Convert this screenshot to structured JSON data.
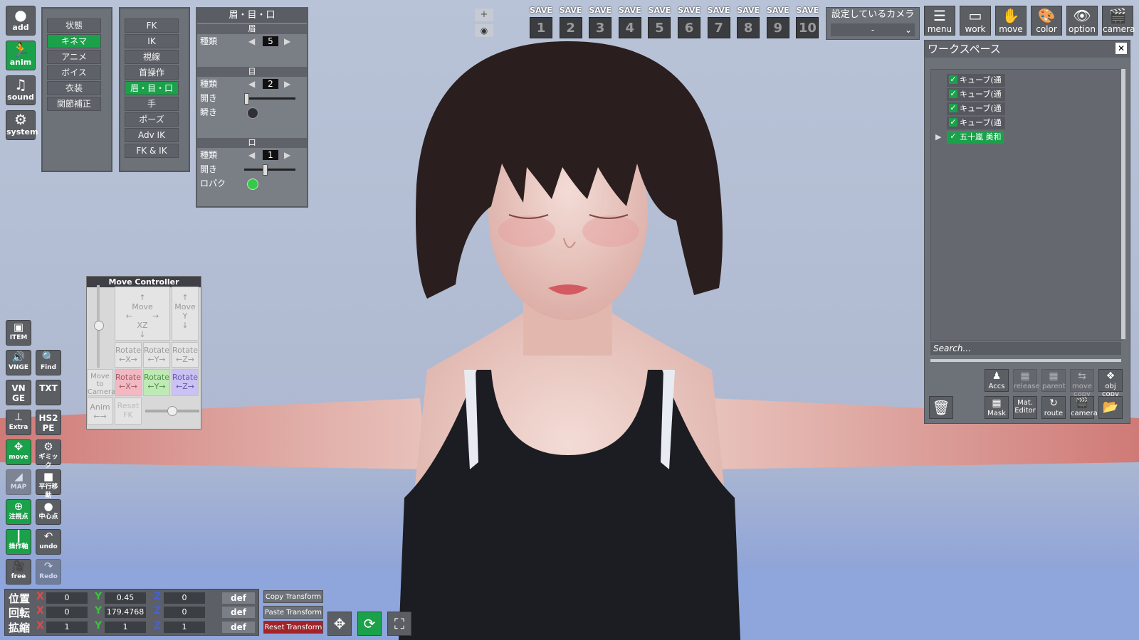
{
  "leftbar_top": [
    {
      "name": "add-button",
      "icon": "person-icon",
      "label": "add",
      "green": false
    },
    {
      "name": "anim-button",
      "icon": "running-person-icon",
      "label": "anim",
      "green": true
    },
    {
      "name": "sound-button",
      "icon": "music-note-icon",
      "label": "sound",
      "green": false
    },
    {
      "name": "system-button",
      "icon": "gears-icon",
      "label": "system",
      "green": false
    }
  ],
  "menu1": {
    "items": [
      "状態",
      "キネマ",
      "アニメ",
      "ボイス",
      "衣装",
      "関節補正"
    ],
    "active": 1
  },
  "menu2": {
    "items": [
      "FK",
      "IK",
      "視線",
      "首操作",
      "眉・目・口",
      "手",
      "ポーズ",
      "Adv IK",
      "FK & IK"
    ],
    "active": 4
  },
  "face_panel": {
    "title": "眉・目・口",
    "brow": {
      "header": "眉",
      "type_label": "種類",
      "type_value": "5"
    },
    "eye": {
      "header": "目",
      "type_label": "種類",
      "type_value": "2",
      "open_label": "開き",
      "blink_label": "瞬き"
    },
    "mouth": {
      "header": "口",
      "type_label": "種類",
      "type_value": "1",
      "open_label": "開き",
      "lipsync_label": "ロパク"
    }
  },
  "view_buttons": {
    "plus": "+",
    "eye": "eye-icon"
  },
  "saves": {
    "label": "SAVE",
    "slots": [
      "1",
      "2",
      "3",
      "4",
      "5",
      "6",
      "7",
      "8",
      "9",
      "10"
    ]
  },
  "camera": {
    "title": "設定しているカメラ",
    "value": "-"
  },
  "top_buttons": [
    {
      "name": "menu-button",
      "icon": "menu-list-icon",
      "label": "menu"
    },
    {
      "name": "work-button",
      "icon": "frame-icon",
      "label": "work"
    },
    {
      "name": "move-button",
      "icon": "hand-icon",
      "label": "move"
    },
    {
      "name": "color-button",
      "icon": "palette-icon",
      "label": "color"
    },
    {
      "name": "option-button",
      "icon": "eye-icon",
      "label": "option"
    },
    {
      "name": "camera-button",
      "icon": "camera-icon",
      "label": "camera"
    }
  ],
  "workspace": {
    "title": "ワークスペース",
    "close": "✕",
    "items": [
      {
        "label": "キューブ(通常)",
        "selected": false
      },
      {
        "label": "キューブ(通常)",
        "selected": false
      },
      {
        "label": "キューブ(通常)",
        "selected": false
      },
      {
        "label": "キューブ(通常)",
        "selected": false
      },
      {
        "label": "五十嵐 美和",
        "selected": true
      }
    ],
    "search_placeholder": "Search...",
    "buttons_row1": [
      "Accs",
      "release",
      "parent",
      "move copy",
      "obj copy"
    ],
    "buttons_row2": [
      "Mask",
      "Mat. Editor",
      "route",
      "camera",
      ""
    ]
  },
  "move_controller": {
    "title": "Move Controller",
    "move_xz": [
      "Move",
      "XZ"
    ],
    "move_y": [
      "Move",
      "Y"
    ],
    "rotate": "Rotate",
    "rx": "←X→",
    "ry": "←Y→",
    "rz": "←Z→",
    "move_to_camera": "Move to Camera",
    "anim": "Anim",
    "reset_fk": "Reset FK"
  },
  "leftbar_bottom": [
    {
      "name": "item-button",
      "icon": "item-icon",
      "label": "ITEM"
    },
    {
      "name": "vngesound-button",
      "icon": "speaker-icon",
      "label": "VNGE"
    },
    {
      "name": "find-button",
      "icon": "magnifier-icon",
      "label": "Find"
    },
    {
      "name": "vnge-button",
      "icon": "",
      "label": "VN GE"
    },
    {
      "name": "vngetxt-button",
      "icon": "",
      "label": "TXT"
    },
    {
      "name": "extra-button",
      "icon": "axes-icon",
      "label": "Extra"
    },
    {
      "name": "hs2pe-button",
      "icon": "",
      "label": "HS2 PE"
    },
    {
      "name": "move-tool-button",
      "icon": "move-arrows-icon",
      "label": "move"
    },
    {
      "name": "gimmick-button",
      "icon": "gear-icon",
      "label": "ギミック"
    },
    {
      "name": "map-button",
      "icon": "map-icon",
      "label": "MAP"
    },
    {
      "name": "parallel-move-button",
      "icon": "square-icon",
      "label": "平行移動"
    },
    {
      "name": "focus-point-button",
      "icon": "crosshair-icon",
      "label": "注視点"
    },
    {
      "name": "center-point-button",
      "icon": "circle-icon",
      "label": "中心点"
    },
    {
      "name": "operation-axis-button",
      "icon": "axis-icon",
      "label": "操作軸"
    },
    {
      "name": "undo-button",
      "icon": "undo-arrow-icon",
      "label": "undo"
    },
    {
      "name": "free-camera-button",
      "icon": "movie-camera-icon",
      "label": "free"
    },
    {
      "name": "redo-button",
      "icon": "redo-arrow-icon",
      "label": "Redo"
    }
  ],
  "transform": {
    "position_label": "位置",
    "rotation_label": "回転",
    "scale_label": "拡縮",
    "axis_x": "X",
    "axis_y": "Y",
    "axis_z": "Z",
    "position": [
      "0",
      "0.45",
      "0"
    ],
    "rotation": [
      "0",
      "179.4768",
      "0"
    ],
    "scale": [
      "1",
      "1",
      "1"
    ],
    "def": "def",
    "copy": "Copy Transform",
    "paste": "Paste Transform",
    "reset": "Reset Transform"
  },
  "colors": {
    "accent_green": "#1aa14a",
    "reset_red": "#a1242a"
  }
}
